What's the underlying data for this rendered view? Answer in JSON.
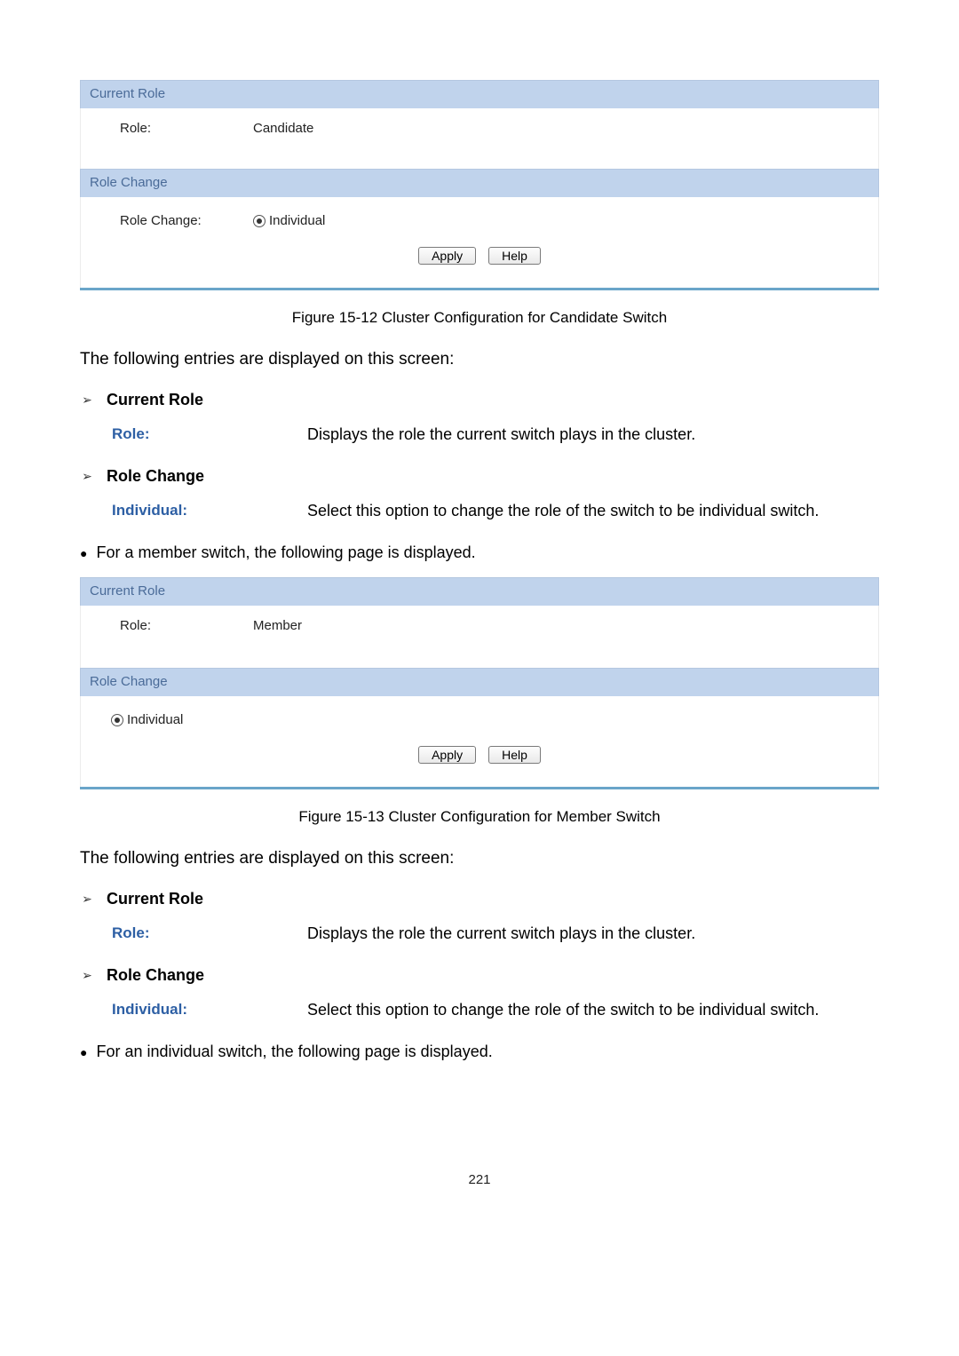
{
  "candidate_panel": {
    "section1_header": "Current Role",
    "role_label": "Role:",
    "role_value": "Candidate",
    "section2_header": "Role Change",
    "role_change_label": "Role Change:",
    "radio_label": "Individual",
    "apply_btn": "Apply",
    "help_btn": "Help"
  },
  "figure1_caption": "Figure 15-12 Cluster Configuration for Candidate Switch",
  "intro1": "The following entries are displayed on this screen:",
  "block1": {
    "head1": "Current Role",
    "term1": "Role:",
    "desc1": "Displays the role the current switch plays in the cluster.",
    "head2": "Role Change",
    "term2": "Individual:",
    "desc2": "Select this option to change the role of the switch to be individual switch."
  },
  "bullet1": "For a member switch, the following page is displayed.",
  "member_panel": {
    "section1_header": "Current Role",
    "role_label": "Role:",
    "role_value": "Member",
    "section2_header": "Role Change",
    "radio_label": "Individual",
    "apply_btn": "Apply",
    "help_btn": "Help"
  },
  "figure2_caption": "Figure 15-13 Cluster Configuration for Member Switch",
  "intro2": "The following entries are displayed on this screen:",
  "block2": {
    "head1": "Current Role",
    "term1": "Role:",
    "desc1": "Displays the role the current switch plays in the cluster.",
    "head2": "Role Change",
    "term2": "Individual:",
    "desc2": "Select this option to change the role of the switch to be individual switch."
  },
  "bullet2": "For an individual switch, the following page is displayed.",
  "page_number": "221"
}
